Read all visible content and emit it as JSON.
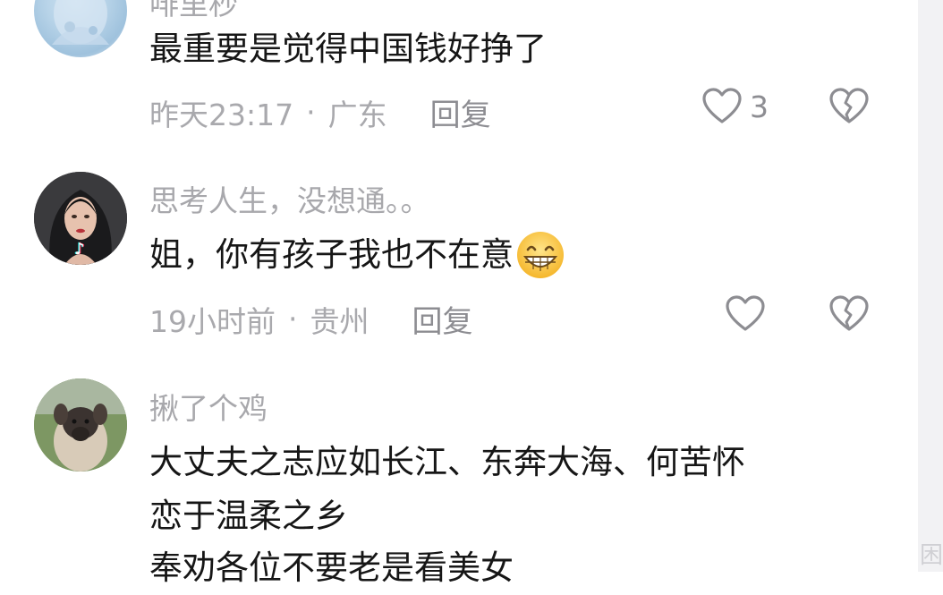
{
  "comments": [
    {
      "username": "啡里秒",
      "text": "最重要是觉得中国钱好挣了",
      "time": "昨天23:17",
      "location": "广东",
      "reply_label": "回复",
      "like_count": "3"
    },
    {
      "username": "思考人生，没想通。。",
      "text": "姐，你有孩子我也不在意",
      "time": "19小时前",
      "location": "贵州",
      "reply_label": "回复",
      "like_count": ""
    },
    {
      "username": "揪了个鸡",
      "text_lines": [
        "大丈夫之志应如长江、东奔大海、何苦怀",
        "恋于温柔之乡",
        "奉劝各位不要老是看美女"
      ]
    }
  ],
  "meta_separator": "·",
  "icons": {
    "like": "heart-outline-icon",
    "dislike": "broken-heart-icon",
    "emoji": "grinning-face-emoji-icon",
    "badge": "tiktok-badge-icon"
  },
  "colors": {
    "text": "#161616",
    "secondary": "#a9a9ad",
    "icon": "#8d8d92"
  }
}
